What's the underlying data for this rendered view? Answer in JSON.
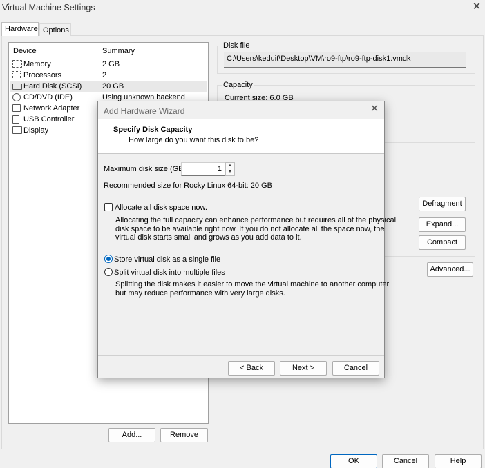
{
  "window": {
    "title": "Virtual Machine Settings",
    "close_glyph": "✕"
  },
  "tabs": [
    {
      "label": "Hardware",
      "selected": true
    },
    {
      "label": "Options",
      "selected": false
    }
  ],
  "device_list": {
    "columns": {
      "device": "Device",
      "summary": "Summary"
    },
    "rows": [
      {
        "icon": "memory-icon",
        "name": "Memory",
        "summary": "2 GB"
      },
      {
        "icon": "processor-icon",
        "name": "Processors",
        "summary": "2"
      },
      {
        "icon": "hard-disk-icon",
        "name": "Hard Disk (SCSI)",
        "summary": "20 GB",
        "selected": true
      },
      {
        "icon": "cd-dvd-icon",
        "name": "CD/DVD (IDE)",
        "summary": "Using unknown backend"
      },
      {
        "icon": "network-adapter-icon",
        "name": "Network Adapter",
        "summary": ""
      },
      {
        "icon": "usb-controller-icon",
        "name": "USB Controller",
        "summary": ""
      },
      {
        "icon": "display-icon",
        "name": "Display",
        "summary": ""
      }
    ]
  },
  "list_buttons": {
    "add": "Add...",
    "remove": "Remove"
  },
  "disk_file": {
    "title": "Disk file",
    "path": "C:\\Users\\keduit\\Desktop\\VM\\ro9-ftp\\ro9-ftp-disk1.vmdk"
  },
  "capacity": {
    "title": "Capacity",
    "current_size": "Current size: 6.0 GB"
  },
  "disk_buttons": {
    "defragment": "Defragment",
    "expand": "Expand...",
    "compact": "Compact",
    "advanced": "Advanced..."
  },
  "footer_buttons": {
    "ok": "OK",
    "cancel": "Cancel",
    "help": "Help"
  },
  "dialog": {
    "title": "Add Hardware Wizard",
    "close_glyph": "✕",
    "heading": "Specify Disk Capacity",
    "subheading": "How large do you want this disk to be?",
    "max_size_label": "Maximum disk size (GB):",
    "max_size_value": "1",
    "recommended": "Recommended size for Rocky Linux 64-bit: 20 GB",
    "allocate_label": "Allocate all disk space now.",
    "allocate_checked": false,
    "allocate_desc": [
      "Allocating the full capacity can enhance performance but requires all of the physical",
      "disk space to be available right now. If you do not allocate all the space now, the",
      "virtual disk starts small and grows as you add data to it."
    ],
    "single_file_label": "Store virtual disk as a single file",
    "single_file_selected": true,
    "split_label": "Split virtual disk into multiple files",
    "split_desc": [
      "Splitting the disk makes it easier to move the virtual machine to another computer",
      "but may reduce performance with very large disks."
    ],
    "buttons": {
      "back": "< Back",
      "next": "Next >",
      "cancel": "Cancel"
    }
  },
  "colors": {
    "accent": "#0067c0",
    "selection": "#e8e8e8"
  }
}
